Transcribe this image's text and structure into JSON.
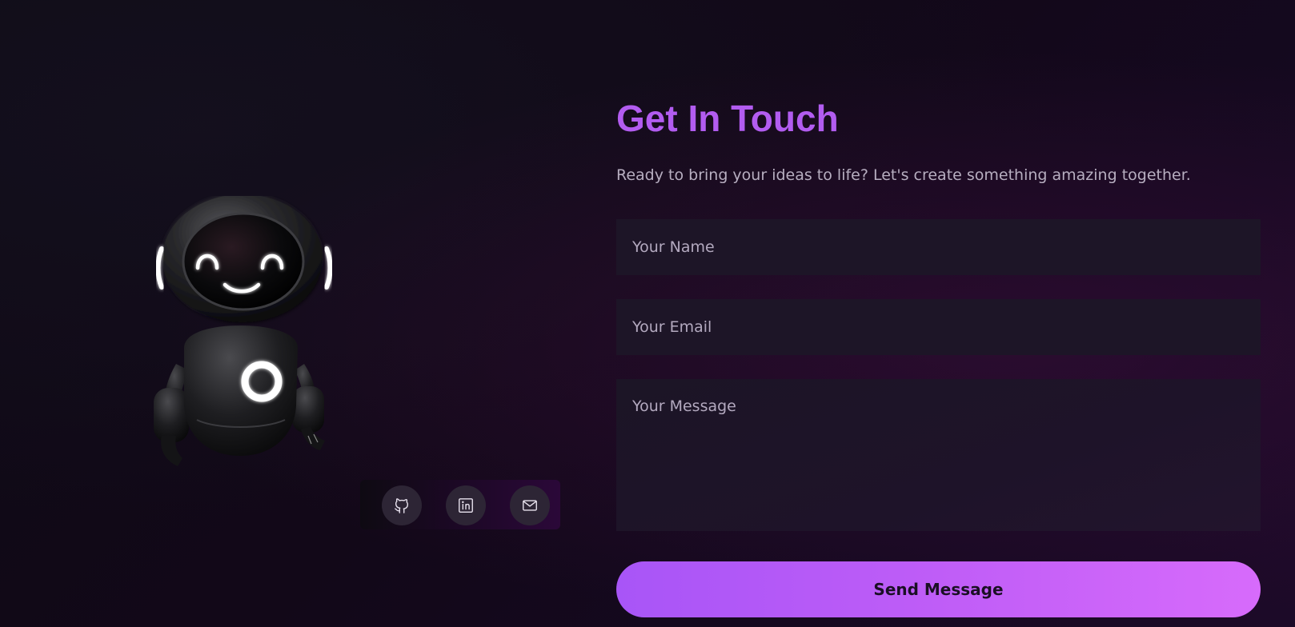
{
  "contact": {
    "title": "Get In Touch",
    "subtitle": "Ready to bring your ideas to life? Let's create something amazing together.",
    "fields": {
      "name_placeholder": "Your Name",
      "email_placeholder": "Your Email",
      "message_placeholder": "Your Message"
    },
    "submit_label": "Send Message"
  },
  "social": {
    "links": [
      {
        "icon": "github-icon"
      },
      {
        "icon": "linkedin-icon"
      },
      {
        "icon": "mail-icon"
      }
    ]
  },
  "illustration": {
    "icon": "robot-mascot"
  },
  "colors": {
    "accent": "#b25cf0",
    "button_gradient_start": "#a855f7",
    "button_gradient_end": "#d76bfb",
    "field_background": "#1d1527",
    "page_background": "#120818"
  }
}
